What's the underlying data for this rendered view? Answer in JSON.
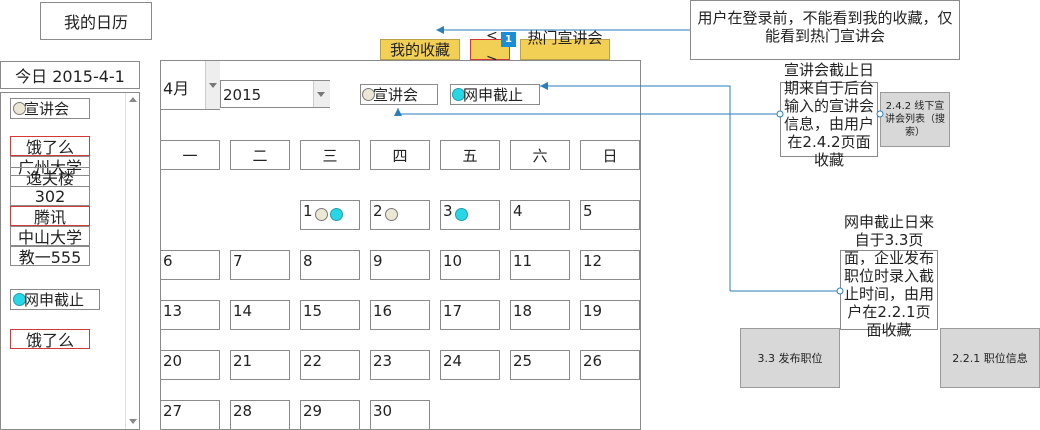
{
  "title": "我的日历",
  "today": "今日 2015-4-1",
  "sidebar": {
    "xuanjiang_label": "宣讲会",
    "items": [
      "饿了么",
      "广州大学",
      "逸夫楼",
      "302",
      "腾讯",
      "中山大学",
      "教一555"
    ],
    "wangshen_label": "网申截止",
    "deadline_item": "饿了么"
  },
  "tabs": {
    "my_favorites": "我的收藏",
    "badge": "1",
    "hot_talks": "热门宣讲会",
    "arrow_left": "<",
    "arrow_right": ">"
  },
  "filters": {
    "month": "4月",
    "year": "2015",
    "xuanjiang": "宣讲会",
    "wangshen": "网申截止"
  },
  "weekdays": [
    "一",
    "二",
    "三",
    "四",
    "五",
    "六",
    "日"
  ],
  "days": [
    "1",
    "2",
    "3",
    "4",
    "5",
    "6",
    "7",
    "8",
    "9",
    "10",
    "11",
    "12",
    "13",
    "14",
    "15",
    "16",
    "17",
    "18",
    "19",
    "20",
    "21",
    "22",
    "23",
    "24",
    "25",
    "26",
    "27",
    "28",
    "29",
    "30"
  ],
  "notes": {
    "login": "用户在登录前，不能看到我的收藏，仅能看到热门宣讲会",
    "talk_source": "宣讲会截止日期来自于后台输入的宣讲会信息，由用户在2.4.2页面收藏",
    "deadline_source": "网申截止日来自于3.3页面，企业发布职位时录入截止时间，由用户在2.2.1页面收藏"
  },
  "refs": {
    "offline_list": "2.4.2 线下宣讲会列表（搜索）",
    "post_job": "3.3 发布职位",
    "job_info": "2.2.1 职位信息"
  },
  "colors": {
    "yellow_tab": "#f2cf55",
    "cyan_dot": "#28d7e6",
    "red_border": "#d23a3a",
    "arrow_blue": "#2a7fb8"
  }
}
